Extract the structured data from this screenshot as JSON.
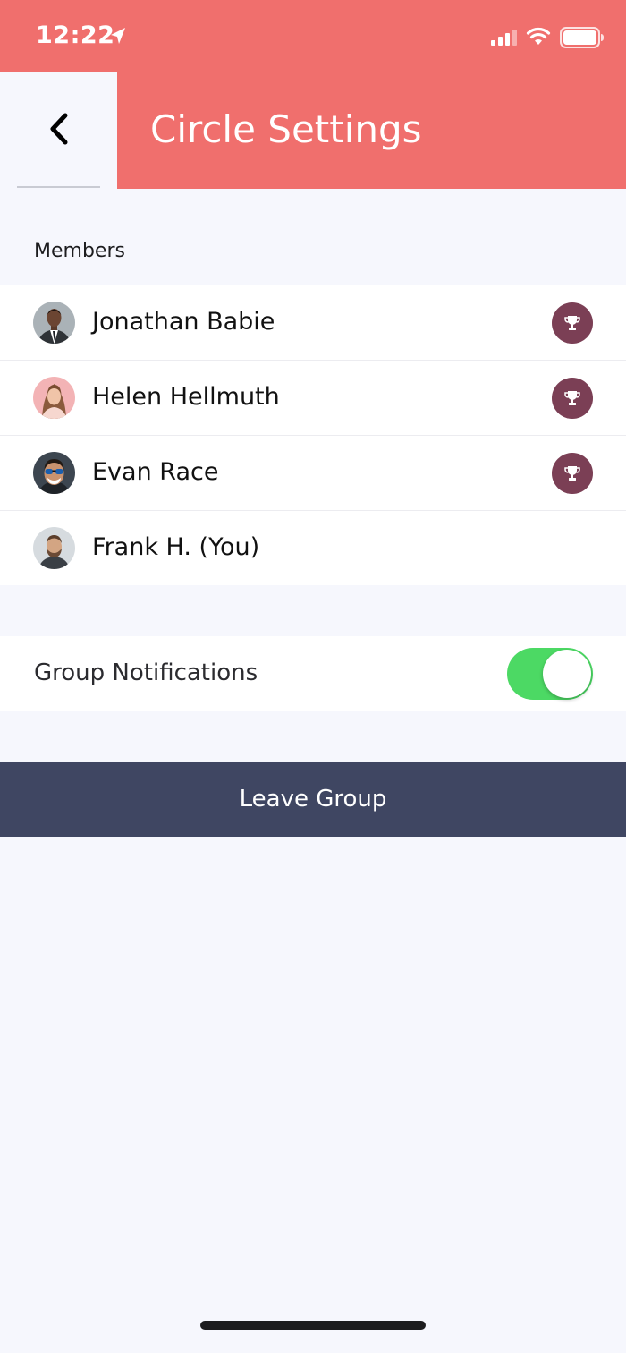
{
  "status_bar": {
    "time": "12:22",
    "icons": [
      "location-arrow-icon",
      "cellular-signal-icon",
      "wifi-icon",
      "battery-icon"
    ]
  },
  "header": {
    "title": "Circle Settings",
    "back_icon": "chevron-left-icon"
  },
  "members_section": {
    "label": "Members",
    "members": [
      {
        "name": "Jonathan Babie",
        "avatar": "avatar-man-suit",
        "trophy": true
      },
      {
        "name": "Helen Hellmuth",
        "avatar": "avatar-woman",
        "trophy": true
      },
      {
        "name": "Evan Race",
        "avatar": "avatar-man-sunglasses",
        "trophy": true
      },
      {
        "name": "Frank H. (You)",
        "avatar": "avatar-man-beard",
        "trophy": false
      }
    ]
  },
  "notifications": {
    "label": "Group Notifications",
    "enabled": true
  },
  "actions": {
    "leave_label": "Leave Group"
  },
  "colors": {
    "accent": "#f06f6d",
    "background": "#f6f7fd",
    "trophy_badge": "#7b3f55",
    "toggle_on": "#4cd964",
    "leave_button": "#3f4662"
  }
}
